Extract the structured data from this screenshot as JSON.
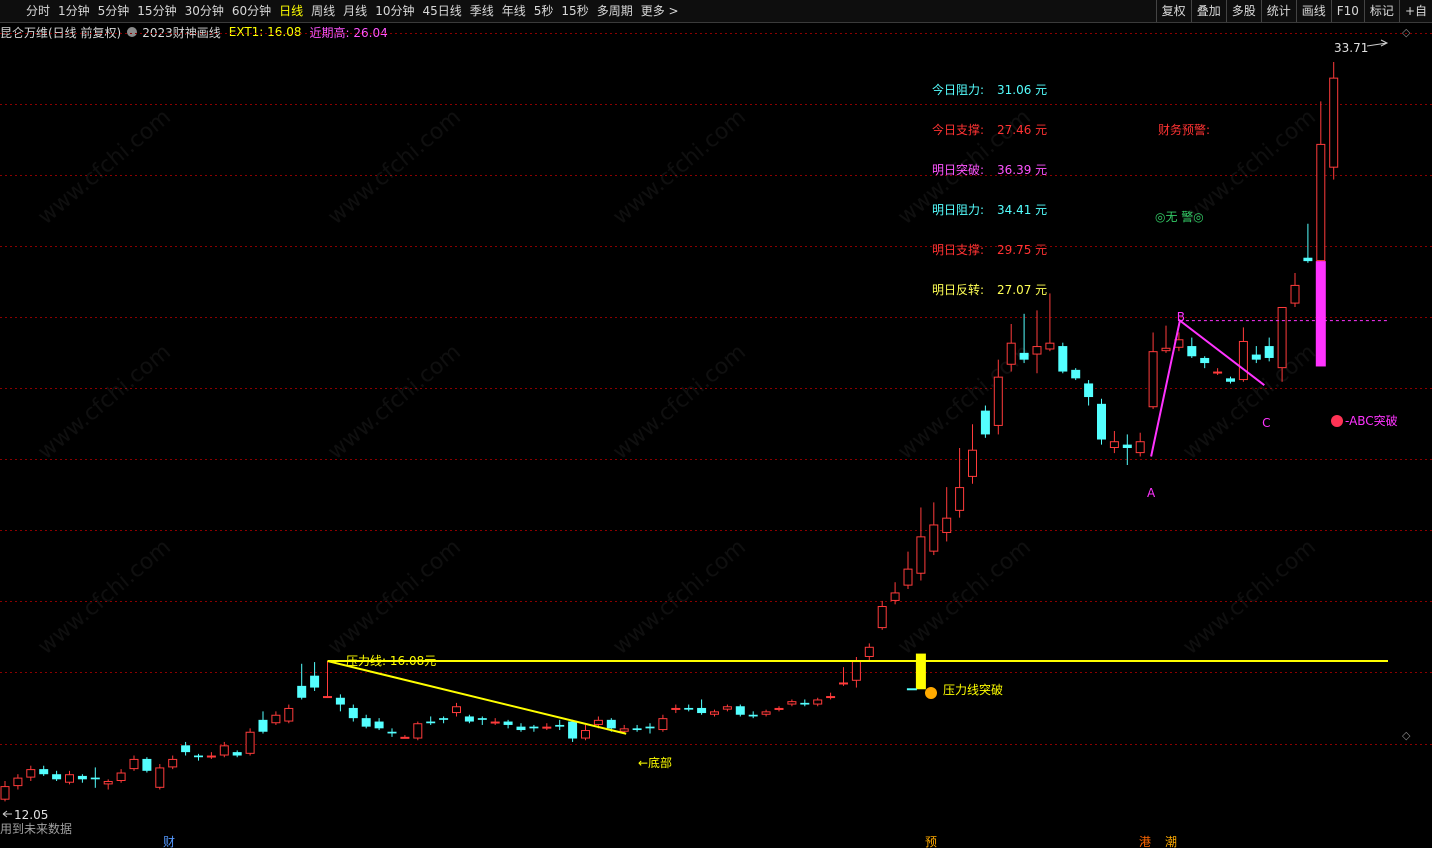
{
  "toolbar": {
    "periods": [
      {
        "label": "分时",
        "active": false
      },
      {
        "label": "1分钟",
        "active": false
      },
      {
        "label": "5分钟",
        "active": false
      },
      {
        "label": "15分钟",
        "active": false
      },
      {
        "label": "30分钟",
        "active": false
      },
      {
        "label": "60分钟",
        "active": false
      },
      {
        "label": "日线",
        "active": true
      },
      {
        "label": "周线",
        "active": false
      },
      {
        "label": "月线",
        "active": false
      },
      {
        "label": "10分钟",
        "active": false
      },
      {
        "label": "45日线",
        "active": false
      },
      {
        "label": "季线",
        "active": false
      },
      {
        "label": "年线",
        "active": false
      },
      {
        "label": "5秒",
        "active": false
      },
      {
        "label": "15秒",
        "active": false
      },
      {
        "label": "多周期",
        "active": false
      },
      {
        "label": "更多 >",
        "active": false
      }
    ],
    "right_buttons": [
      "复权",
      "叠加",
      "多股",
      "统计",
      "画线",
      "F10",
      "标记",
      "+自"
    ]
  },
  "title": {
    "stock": "昆仑万维(日线 前复权)",
    "indicator": "2023财神画线",
    "ext1": "EXT1: 16.08",
    "recent_high": "近期高: 26.04"
  },
  "levels": [
    {
      "label": "今日阻力:",
      "value": "31.06 元",
      "color": "#55ffff"
    },
    {
      "label": "今日支撑:",
      "value": "27.46 元",
      "color": "#ff3333"
    },
    {
      "label": "明日突破:",
      "value": "36.39 元",
      "color": "#ff55ff"
    },
    {
      "label": "明日阻力:",
      "value": "34.41 元",
      "color": "#55ffff"
    },
    {
      "label": "明日支撑:",
      "value": "29.75 元",
      "color": "#ff3333"
    },
    {
      "label": "明日反转:",
      "value": "27.07 元",
      "color": "#ffff55"
    }
  ],
  "annotations": {
    "finance_warning": "财务预警:",
    "no_warning": "◎无 警◎",
    "pressure_line": "压力线: 16.08元",
    "pressure_break": "压力线突破",
    "bottom": "←底部",
    "abc_break": "ABC突破",
    "point_a": "A",
    "point_b": "B",
    "point_c": "C",
    "price_high": "33.71",
    "price_low": "12.05",
    "future_data": "用到未来数据",
    "watermark": "www.cfchi.com"
  },
  "bottom_marks": [
    {
      "label": "财",
      "color": "#5599ff"
    },
    {
      "label": "预",
      "color": "#ffaa00"
    },
    {
      "label": "港",
      "color": "#ff6600"
    },
    {
      "label": "潮",
      "color": "#ffaa00"
    }
  ],
  "colors": {
    "up": "#ff3b3b",
    "down": "#54ffff",
    "pressure": "#ffff00",
    "abc": "#ff33ff",
    "grid": "#8b0000"
  },
  "chart_data": {
    "type": "candlestick",
    "y_range_visible": [
      12.05,
      33.71
    ],
    "pressure_line_value": 16.08,
    "candles": [
      {
        "o": 12.0,
        "c": 12.4,
        "h": 12.55,
        "l": 11.95
      },
      {
        "o": 12.4,
        "c": 12.65,
        "h": 12.75,
        "l": 12.3
      },
      {
        "o": 12.65,
        "c": 12.9,
        "h": 13.0,
        "l": 12.55
      },
      {
        "o": 12.9,
        "c": 12.75,
        "h": 13.0,
        "l": 12.7
      },
      {
        "o": 12.75,
        "c": 12.6,
        "h": 12.85,
        "l": 12.55
      },
      {
        "o": 12.5,
        "c": 12.75,
        "h": 12.85,
        "l": 12.45
      },
      {
        "o": 12.7,
        "c": 12.6,
        "h": 12.75,
        "l": 12.5
      },
      {
        "o": 12.65,
        "c": 12.6,
        "h": 12.95,
        "l": 12.35
      },
      {
        "o": 12.45,
        "c": 12.55,
        "h": 12.6,
        "l": 12.3
      },
      {
        "o": 12.55,
        "c": 12.8,
        "h": 12.9,
        "l": 12.5
      },
      {
        "o": 12.9,
        "c": 13.2,
        "h": 13.3,
        "l": 12.85
      },
      {
        "o": 13.2,
        "c": 12.85,
        "h": 13.25,
        "l": 12.8
      },
      {
        "o": 12.35,
        "c": 12.95,
        "h": 13.05,
        "l": 12.3
      },
      {
        "o": 12.95,
        "c": 13.2,
        "h": 13.3,
        "l": 12.9
      },
      {
        "o": 13.6,
        "c": 13.4,
        "h": 13.7,
        "l": 13.3
      },
      {
        "o": 13.3,
        "c": 13.25,
        "h": 13.35,
        "l": 13.15
      },
      {
        "o": 13.25,
        "c": 13.3,
        "h": 13.4,
        "l": 13.2
      },
      {
        "o": 13.3,
        "c": 13.6,
        "h": 13.7,
        "l": 13.25
      },
      {
        "o": 13.4,
        "c": 13.3,
        "h": 13.45,
        "l": 13.25
      },
      {
        "o": 13.35,
        "c": 14.0,
        "h": 14.1,
        "l": 13.3
      },
      {
        "o": 14.35,
        "c": 14.0,
        "h": 14.6,
        "l": 13.95
      },
      {
        "o": 14.25,
        "c": 14.5,
        "h": 14.6,
        "l": 14.2
      },
      {
        "o": 14.3,
        "c": 14.7,
        "h": 14.8,
        "l": 14.25
      },
      {
        "o": 15.35,
        "c": 15.0,
        "h": 16.0,
        "l": 14.95
      },
      {
        "o": 15.65,
        "c": 15.3,
        "h": 16.05,
        "l": 15.2
      },
      {
        "o": 15.0,
        "c": 15.05,
        "h": 16.08,
        "l": 15.0
      },
      {
        "o": 15.0,
        "c": 14.8,
        "h": 15.1,
        "l": 14.6
      },
      {
        "o": 14.7,
        "c": 14.4,
        "h": 14.8,
        "l": 14.3
      },
      {
        "o": 14.4,
        "c": 14.15,
        "h": 14.5,
        "l": 14.1
      },
      {
        "o": 14.3,
        "c": 14.1,
        "h": 14.4,
        "l": 14.05
      },
      {
        "o": 14.0,
        "c": 13.95,
        "h": 14.1,
        "l": 13.85
      },
      {
        "o": 13.85,
        "c": 13.85,
        "h": 13.9,
        "l": 13.8
      },
      {
        "o": 13.8,
        "c": 14.25,
        "h": 14.3,
        "l": 13.75
      },
      {
        "o": 14.3,
        "c": 14.25,
        "h": 14.45,
        "l": 14.2
      },
      {
        "o": 14.4,
        "c": 14.35,
        "h": 14.45,
        "l": 14.25
      },
      {
        "o": 14.55,
        "c": 14.75,
        "h": 14.85,
        "l": 14.45
      },
      {
        "o": 14.45,
        "c": 14.3,
        "h": 14.5,
        "l": 14.25
      },
      {
        "o": 14.4,
        "c": 14.35,
        "h": 14.45,
        "l": 14.2
      },
      {
        "o": 14.25,
        "c": 14.3,
        "h": 14.4,
        "l": 14.2
      },
      {
        "o": 14.3,
        "c": 14.2,
        "h": 14.35,
        "l": 14.1
      },
      {
        "o": 14.15,
        "c": 14.05,
        "h": 14.25,
        "l": 14.0
      },
      {
        "o": 14.15,
        "c": 14.1,
        "h": 14.2,
        "l": 14.0
      },
      {
        "o": 14.1,
        "c": 14.15,
        "h": 14.25,
        "l": 14.05
      },
      {
        "o": 14.2,
        "c": 14.15,
        "h": 14.35,
        "l": 14.05
      },
      {
        "o": 14.3,
        "c": 13.8,
        "h": 14.35,
        "l": 13.7
      },
      {
        "o": 13.8,
        "c": 14.05,
        "h": 14.2,
        "l": 13.75
      },
      {
        "o": 14.2,
        "c": 14.35,
        "h": 14.45,
        "l": 14.1
      },
      {
        "o": 14.35,
        "c": 14.1,
        "h": 14.4,
        "l": 14.0
      },
      {
        "o": 14.0,
        "c": 14.1,
        "h": 14.2,
        "l": 13.95
      },
      {
        "o": 14.1,
        "c": 14.05,
        "h": 14.2,
        "l": 14.0
      },
      {
        "o": 14.15,
        "c": 14.1,
        "h": 14.25,
        "l": 13.95
      },
      {
        "o": 14.05,
        "c": 14.4,
        "h": 14.5,
        "l": 14.0
      },
      {
        "o": 14.65,
        "c": 14.7,
        "h": 14.8,
        "l": 14.55
      },
      {
        "o": 14.7,
        "c": 14.65,
        "h": 14.8,
        "l": 14.6
      },
      {
        "o": 14.7,
        "c": 14.55,
        "h": 14.95,
        "l": 14.5
      },
      {
        "o": 14.5,
        "c": 14.6,
        "h": 14.65,
        "l": 14.45
      },
      {
        "o": 14.65,
        "c": 14.75,
        "h": 14.8,
        "l": 14.6
      },
      {
        "o": 14.75,
        "c": 14.5,
        "h": 14.8,
        "l": 14.45
      },
      {
        "o": 14.5,
        "c": 14.45,
        "h": 14.6,
        "l": 14.4
      },
      {
        "o": 14.5,
        "c": 14.6,
        "h": 14.65,
        "l": 14.45
      },
      {
        "o": 14.65,
        "c": 14.7,
        "h": 14.75,
        "l": 14.6
      },
      {
        "o": 14.8,
        "c": 14.9,
        "h": 14.95,
        "l": 14.75
      },
      {
        "o": 14.85,
        "c": 14.8,
        "h": 14.95,
        "l": 14.75
      },
      {
        "o": 14.8,
        "c": 14.95,
        "h": 15.0,
        "l": 14.75
      },
      {
        "o": 15.0,
        "c": 15.05,
        "h": 15.15,
        "l": 14.95
      },
      {
        "o": 15.4,
        "c": 15.45,
        "h": 15.9,
        "l": 15.35
      },
      {
        "o": 15.5,
        "c": 16.08,
        "h": 16.2,
        "l": 15.3
      },
      {
        "o": 16.2,
        "c": 16.5,
        "h": 16.6,
        "l": 16.1
      },
      {
        "o": 17.05,
        "c": 17.7,
        "h": 17.85,
        "l": 17.0
      },
      {
        "o": 17.85,
        "c": 18.1,
        "h": 18.4,
        "l": 17.75
      },
      {
        "o": 18.3,
        "c": 18.8,
        "h": 19.3,
        "l": 18.2
      },
      {
        "o": 18.65,
        "c": 19.75,
        "h": 20.6,
        "l": 18.45
      },
      {
        "o": 19.3,
        "c": 20.1,
        "h": 20.75,
        "l": 19.2
      },
      {
        "o": 19.85,
        "c": 20.3,
        "h": 21.2,
        "l": 19.6
      },
      {
        "o": 20.5,
        "c": 21.2,
        "h": 22.35,
        "l": 20.3
      },
      {
        "o": 21.5,
        "c": 22.3,
        "h": 23.05,
        "l": 21.3
      },
      {
        "o": 23.45,
        "c": 22.75,
        "h": 23.6,
        "l": 22.65
      },
      {
        "o": 23.0,
        "c": 24.45,
        "h": 24.95,
        "l": 22.75
      },
      {
        "o": 24.8,
        "c": 25.45,
        "h": 26.0,
        "l": 24.6
      },
      {
        "o": 25.15,
        "c": 24.95,
        "h": 26.3,
        "l": 24.85
      },
      {
        "o": 25.1,
        "c": 25.35,
        "h": 26.4,
        "l": 24.55
      },
      {
        "o": 25.25,
        "c": 25.45,
        "h": 26.9,
        "l": 25.2
      },
      {
        "o": 25.35,
        "c": 24.6,
        "h": 25.45,
        "l": 24.55
      },
      {
        "o": 24.65,
        "c": 24.4,
        "h": 24.7,
        "l": 24.35
      },
      {
        "o": 24.25,
        "c": 23.85,
        "h": 24.35,
        "l": 23.6
      },
      {
        "o": 23.65,
        "c": 22.6,
        "h": 23.8,
        "l": 22.45
      },
      {
        "o": 22.35,
        "c": 22.55,
        "h": 22.85,
        "l": 22.2
      },
      {
        "o": 22.45,
        "c": 22.35,
        "h": 22.75,
        "l": 21.85
      },
      {
        "o": 22.2,
        "c": 22.55,
        "h": 22.8,
        "l": 22.1
      },
      {
        "o": 23.55,
        "c": 25.2,
        "h": 25.75,
        "l": 23.5
      },
      {
        "o": 25.2,
        "c": 25.3,
        "h": 25.95,
        "l": 25.15
      },
      {
        "o": 25.3,
        "c": 25.55,
        "h": 25.75,
        "l": 25.2
      },
      {
        "o": 25.35,
        "c": 25.05,
        "h": 25.6,
        "l": 25.0
      },
      {
        "o": 25.0,
        "c": 24.85,
        "h": 25.05,
        "l": 24.7
      },
      {
        "o": 24.55,
        "c": 24.6,
        "h": 24.7,
        "l": 24.5
      },
      {
        "o": 24.4,
        "c": 24.3,
        "h": 24.45,
        "l": 24.25
      },
      {
        "o": 24.35,
        "c": 25.5,
        "h": 25.9,
        "l": 24.3
      },
      {
        "o": 25.1,
        "c": 24.95,
        "h": 25.35,
        "l": 24.85
      },
      {
        "o": 25.35,
        "c": 25.0,
        "h": 25.6,
        "l": 24.9
      },
      {
        "o": 24.7,
        "c": 26.5,
        "h": 26.5,
        "l": 24.3
      },
      {
        "o": 26.6,
        "c": 27.15,
        "h": 27.5,
        "l": 26.5
      },
      {
        "o": 27.95,
        "c": 27.85,
        "h": 28.95,
        "l": 27.8
      },
      {
        "o": 27.85,
        "c": 31.3,
        "h": 32.55,
        "l": 27.8
      },
      {
        "o": 30.6,
        "c": 33.25,
        "h": 33.71,
        "l": 30.25
      }
    ],
    "abc": {
      "A": 89,
      "B": 91,
      "C": 97
    }
  }
}
